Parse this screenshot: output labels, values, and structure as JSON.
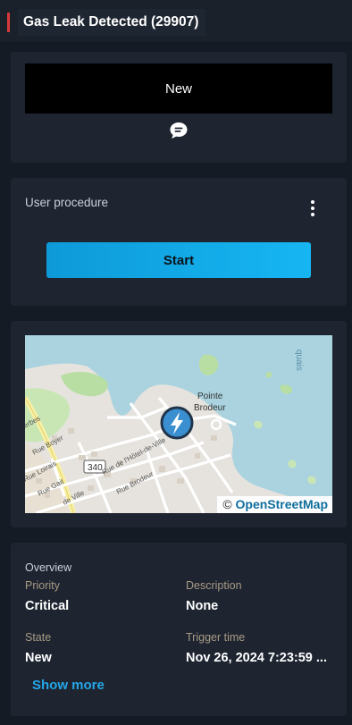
{
  "header": {
    "title": "Gas Leak Detected (29907)",
    "accent_color": "#d9383a"
  },
  "status": {
    "value": "New",
    "comment_icon": "comment-icon"
  },
  "procedure": {
    "label": "User procedure",
    "menu_icon": "more-vertical-icon",
    "start_label": "Start",
    "start_color": "#16b6f3"
  },
  "map": {
    "place_label_1": "Pointe",
    "place_label_2": "Brodeur",
    "route_badge": "340",
    "streets": [
      "Rue de l'Hôtel-de-Ville",
      "Rue Brodeur",
      "Rue Boyer",
      "Rue Gait",
      "Rue Loirais",
      "de Ville",
      "erbes"
    ],
    "marker_icon": "lightning-icon",
    "attribution_symbol": "©",
    "attribution_link": "OpenStreetMap",
    "water_label": "quais"
  },
  "overview": {
    "heading": "Overview",
    "priority_label": "Priority",
    "priority_value": "Critical",
    "description_label": "Description",
    "description_value": "None",
    "state_label": "State",
    "state_value": "New",
    "trigger_label": "Trigger time",
    "trigger_value": "Nov 26, 2024 7:23:59 ...",
    "show_more": "Show more"
  }
}
